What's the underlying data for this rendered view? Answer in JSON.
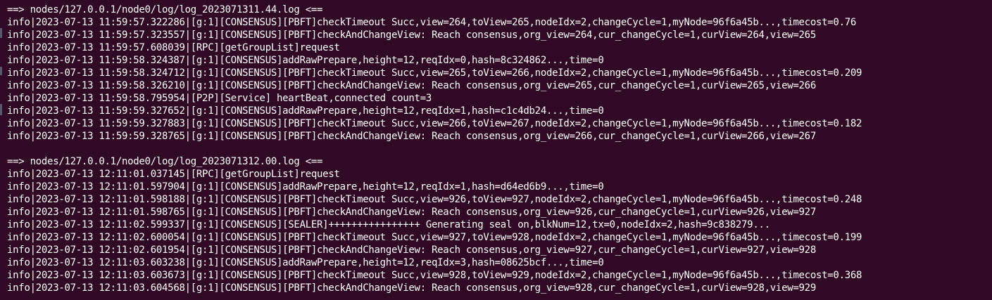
{
  "terminal": {
    "blocks": [
      {
        "header": "==> nodes/127.0.0.1/node0/log/log_2023071311.44.log <==",
        "lines": [
          "info|2023-07-13 11:59:57.322286|[g:1][CONSENSUS][PBFT]checkTimeout Succ,view=264,toView=265,nodeIdx=2,changeCycle=1,myNode=96f6a45b...,timecost=0.76",
          "info|2023-07-13 11:59:57.323557|[g:1][CONSENSUS][PBFT]checkAndChangeView: Reach consensus,org_view=264,cur_changeCycle=1,curView=264,view=265",
          "info|2023-07-13 11:59:57.608039|[RPC][getGroupList]request",
          "info|2023-07-13 11:59:58.324387|[g:1][CONSENSUS]addRawPrepare,height=12,reqIdx=0,hash=8c324862...,time=0",
          "info|2023-07-13 11:59:58.324712|[g:1][CONSENSUS][PBFT]checkTimeout Succ,view=265,toView=266,nodeIdx=2,changeCycle=1,myNode=96f6a45b...,timecost=0.209",
          "info|2023-07-13 11:59:58.326210|[g:1][CONSENSUS][PBFT]checkAndChangeView: Reach consensus,org_view=265,cur_changeCycle=1,curView=265,view=266",
          "info|2023-07-13 11:59:58.795954|[P2P][Service] heartBeat,connected count=3",
          "info|2023-07-13 11:59:59.327652|[g:1][CONSENSUS]addRawPrepare,height=12,reqIdx=1,hash=c1c4db24...,time=0",
          "info|2023-07-13 11:59:59.327883|[g:1][CONSENSUS][PBFT]checkTimeout Succ,view=266,toView=267,nodeIdx=2,changeCycle=1,myNode=96f6a45b...,timecost=0.182",
          "info|2023-07-13 11:59:59.328765|[g:1][CONSENSUS][PBFT]checkAndChangeView: Reach consensus,org_view=266,cur_changeCycle=1,curView=266,view=267"
        ]
      },
      {
        "header": "==> nodes/127.0.0.1/node0/log/log_2023071312.00.log <==",
        "lines": [
          "info|2023-07-13 12:11:01.037145|[RPC][getGroupList]request",
          "info|2023-07-13 12:11:01.597904|[g:1][CONSENSUS]addRawPrepare,height=12,reqIdx=1,hash=d64ed6b9...,time=0",
          "info|2023-07-13 12:11:01.598188|[g:1][CONSENSUS][PBFT]checkTimeout Succ,view=926,toView=927,nodeIdx=2,changeCycle=1,myNode=96f6a45b...,timecost=0.248",
          "info|2023-07-13 12:11:01.598765|[g:1][CONSENSUS][PBFT]checkAndChangeView: Reach consensus,org_view=926,cur_changeCycle=1,curView=926,view=927",
          "info|2023-07-13 12:11:02.599337|[g:1][CONSENSUS][SEALER]++++++++++++++++ Generating seal on,blkNum=12,tx=0,nodeIdx=2,hash=9c838279...",
          "info|2023-07-13 12:11:02.600054|[g:1][CONSENSUS][PBFT]checkTimeout Succ,view=927,toView=928,nodeIdx=2,changeCycle=1,myNode=96f6a45b...,timecost=0.199",
          "info|2023-07-13 12:11:02.601954|[g:1][CONSENSUS][PBFT]checkAndChangeView: Reach consensus,org_view=927,cur_changeCycle=1,curView=927,view=928",
          "info|2023-07-13 12:11:03.603238|[g:1][CONSENSUS]addRawPrepare,height=12,reqIdx=3,hash=08625bcf...,time=0",
          "info|2023-07-13 12:11:03.603673|[g:1][CONSENSUS][PBFT]checkTimeout Succ,view=928,toView=929,nodeIdx=2,changeCycle=1,myNode=96f6a45b...,timecost=0.368",
          "info|2023-07-13 12:11:03.604568|[g:1][CONSENSUS][PBFT]checkAndChangeView: Reach consensus,org_view=928,cur_changeCycle=1,curView=928,view=929"
        ]
      }
    ]
  },
  "colors": {
    "background": "#300a24",
    "text": "#ffffff"
  }
}
